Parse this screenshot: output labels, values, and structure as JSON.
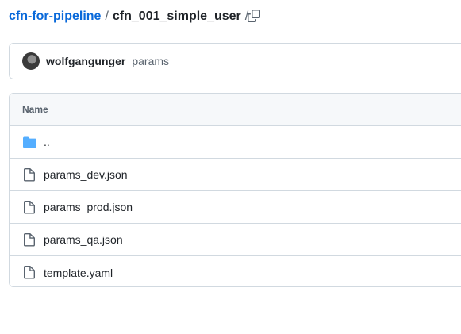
{
  "breadcrumb": {
    "repo": "cfn-for-pipeline",
    "separator": "/",
    "folder": "cfn_001_simple_user",
    "trailing_separator": "/"
  },
  "commit": {
    "author": "wolfgangunger",
    "message": "params"
  },
  "table": {
    "header": "Name",
    "rows": [
      {
        "name": "..",
        "icon": "folder-icon"
      },
      {
        "name": "params_dev.json",
        "icon": "file-icon"
      },
      {
        "name": "params_prod.json",
        "icon": "file-icon"
      },
      {
        "name": "params_qa.json",
        "icon": "file-icon"
      },
      {
        "name": "template.yaml",
        "icon": "file-icon"
      }
    ]
  },
  "colors": {
    "link": "#0969da",
    "folder_icon": "#54aeff",
    "border": "#d1d9e0"
  }
}
